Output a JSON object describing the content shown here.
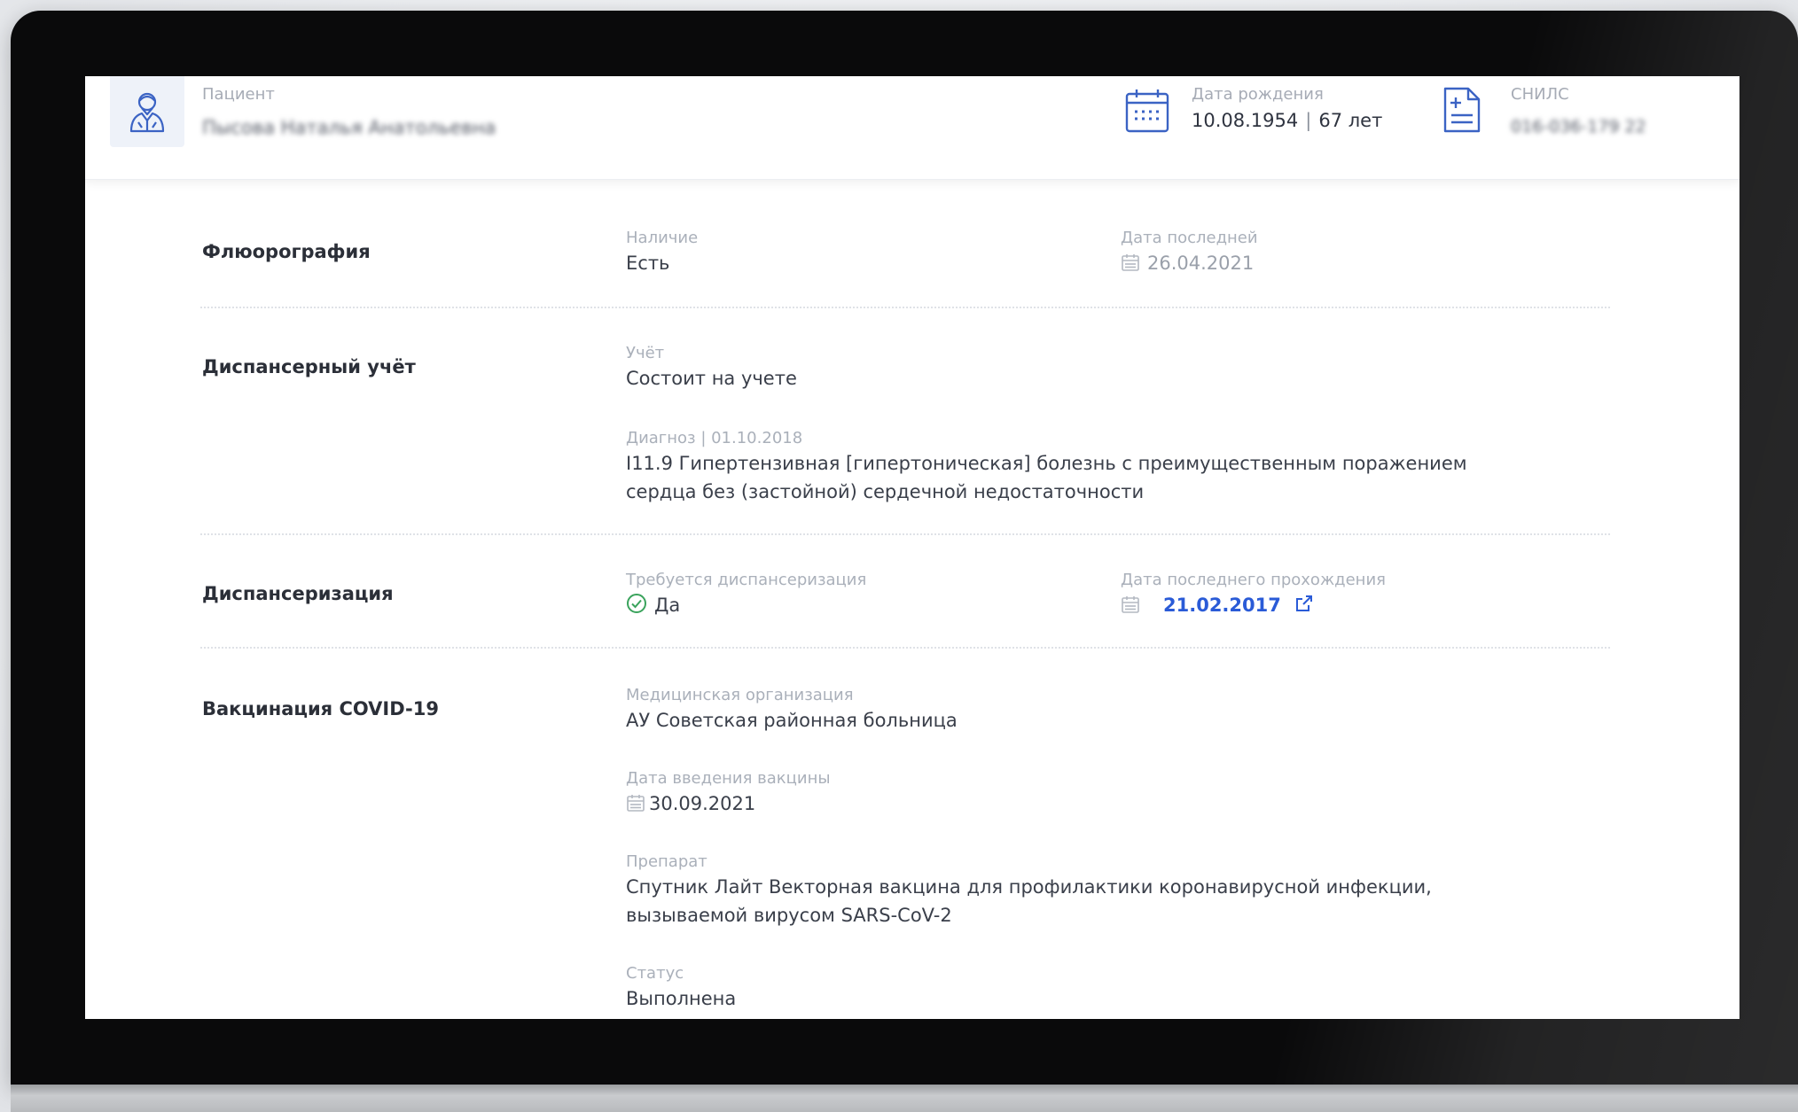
{
  "header": {
    "patient_label": "Пациент",
    "patient_name": "Пысова Наталья Анатольевна",
    "birth_label": "Дата рождения",
    "birth_date": "10.08.1954",
    "age": "67 лет",
    "snils_label": "СНИЛС",
    "snils_value": "016-036-179 22"
  },
  "fluorography": {
    "title": "Флюорография",
    "presence_label": "Наличие",
    "presence_value": "Есть",
    "last_date_label": "Дата последней",
    "last_date_value": "26.04.2021"
  },
  "dispensary_account": {
    "title": "Диспансерный учёт",
    "account_label": "Учёт",
    "account_value": "Состоит на учете",
    "diagnosis_label": "Диагноз | 01.10.2018",
    "diagnosis_line1": "I11.9 Гипертензивная [гипертоническая] болезнь с преимущественным поражением",
    "diagnosis_line2": "сердца без (застойной) сердечной недостаточности"
  },
  "dispensarization": {
    "title": "Диспансеризация",
    "required_label": "Требуется диспансеризация",
    "required_value": "Да",
    "last_label": "Дата последнего прохождения",
    "last_value": "21.02.2017"
  },
  "vaccination": {
    "title": "Вакцинация COVID-19",
    "org_label": "Медицинская организация",
    "org_value": "АУ Советская районная больница",
    "date_label": "Дата введения вакцины",
    "date_value": "30.09.2021",
    "drug_label": "Препарат",
    "drug_line1": "Спутник Лайт Векторная вакцина для профилактики коронавирусной инфекции,",
    "drug_line2": "вызываемой вирусом SARS-CoV-2",
    "status_label": "Статус",
    "status_value": "Выполнена"
  },
  "colors": {
    "accent": "#2a5bd7",
    "success": "#3aa35c",
    "icon": "#3b63c4"
  }
}
